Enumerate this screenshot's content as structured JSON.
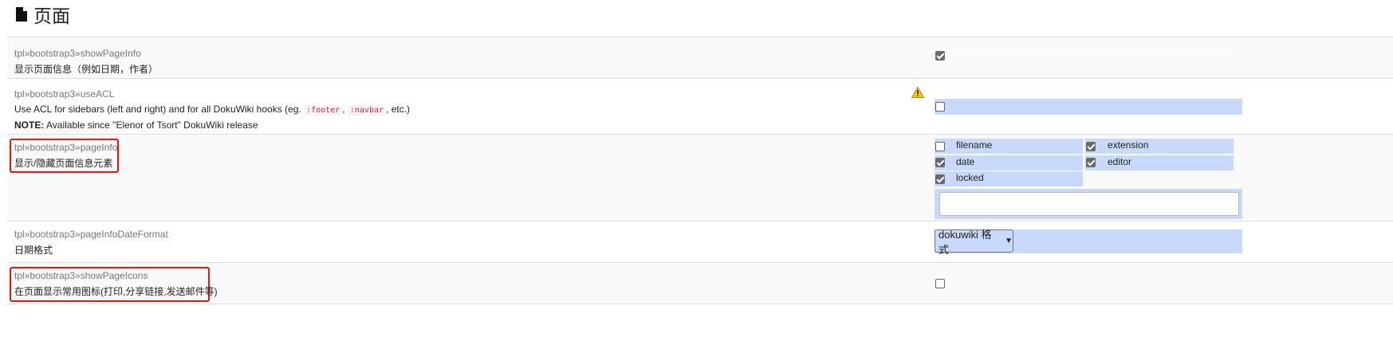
{
  "page": {
    "title": "页面",
    "title_icon": "file-icon"
  },
  "settings": [
    {
      "key": "tpl»bootstrap3»showPageInfo",
      "description": "显示页面信息（例如日期，作者）",
      "control": "checkbox",
      "checked": true,
      "highlighted": false
    },
    {
      "key": "tpl»bootstrap3»useACL",
      "description_parts": {
        "before": "Use ACL for sidebars (left and right) and for all DokuWiki hooks (eg. ",
        "code1": ":footer",
        "sep": ", ",
        "code2": ":navbar",
        "after": ", etc.)"
      },
      "note_label": "NOTE:",
      "note_text": " Available since \"Elenor of Tsort\" DokuWiki release",
      "warning_icon": "warning-icon",
      "control": "checkbox",
      "checked": false,
      "highlighted": false
    },
    {
      "key": "tpl»bootstrap3»pageInfo",
      "description": "显示/隐藏页面信息元素",
      "control": "multicheckbox",
      "options": [
        {
          "label": "filename",
          "checked": false
        },
        {
          "label": "extension",
          "checked": true
        },
        {
          "label": "date",
          "checked": true
        },
        {
          "label": "editor",
          "checked": true
        },
        {
          "label": "locked",
          "checked": true
        }
      ],
      "other_value": "",
      "highlighted": true
    },
    {
      "key": "tpl»bootstrap3»pageInfoDateFormat",
      "description": "日期格式",
      "control": "select",
      "selected": "dokuwiki 格式",
      "highlighted": false
    },
    {
      "key": "tpl»bootstrap3»showPageIcons",
      "description": "在页面显示常用图标(打印,分享链接,发送邮件等)",
      "control": "checkbox",
      "checked": false,
      "highlighted": true
    }
  ],
  "colors": {
    "highlight_border": "#e81414",
    "input_bg": "#c9d9fb",
    "code_text": "#c7254e"
  }
}
